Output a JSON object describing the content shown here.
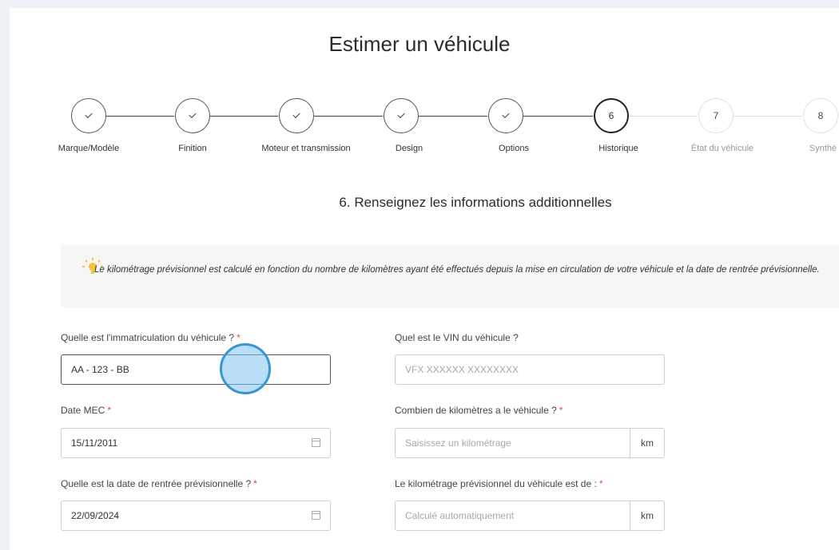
{
  "page": {
    "title": "Estimer un véhicule"
  },
  "stepper": {
    "steps": [
      {
        "label": "Marque/Modèle",
        "state": "done"
      },
      {
        "label": "Finition",
        "state": "done"
      },
      {
        "label": "Moteur et transmission",
        "state": "done"
      },
      {
        "label": "Design",
        "state": "done"
      },
      {
        "label": "Options",
        "state": "done"
      },
      {
        "label": "Historique",
        "state": "current",
        "number": "6"
      },
      {
        "label": "État du véhicule",
        "state": "todo",
        "number": "7"
      },
      {
        "label": "Synthè",
        "state": "todo",
        "number": "8"
      }
    ]
  },
  "section": {
    "title": "6. Renseignez les informations additionnelles"
  },
  "info": {
    "icon": "lightbulb-icon",
    "text": "Le kilométrage prévisionnel est calculé en fonction du nombre de kilomètres ayant été effectués depuis la mise en circulation de votre véhicule et la date de rentrée prévisionnelle."
  },
  "form": {
    "required_mark": "*",
    "immatriculation": {
      "label": "Quelle est l'immatriculation du véhicule ?",
      "value": "AA - 123 - BB"
    },
    "vin": {
      "label": "Quel est le VIN du véhicule ?",
      "placeholder": "VFX XXXXXX XXXXXXXX"
    },
    "date_mec": {
      "label": "Date MEC",
      "value": "15/11/2011"
    },
    "kilometrage": {
      "label": "Combien de kilomètres a le véhicule ?",
      "placeholder": "Saisissez un kilométrage",
      "unit": "km"
    },
    "date_rentree": {
      "label": "Quelle est la date de rentrée prévisionnelle ?",
      "value": "22/09/2024"
    },
    "km_previsionnel": {
      "label": "Le kilométrage prévisionnel du véhicule est de :",
      "placeholder": "Calculé automatiquement",
      "unit": "km"
    }
  },
  "colors": {
    "required": "#e34b3c",
    "cursor": "#3b95cf",
    "background": "#eef1f5"
  }
}
